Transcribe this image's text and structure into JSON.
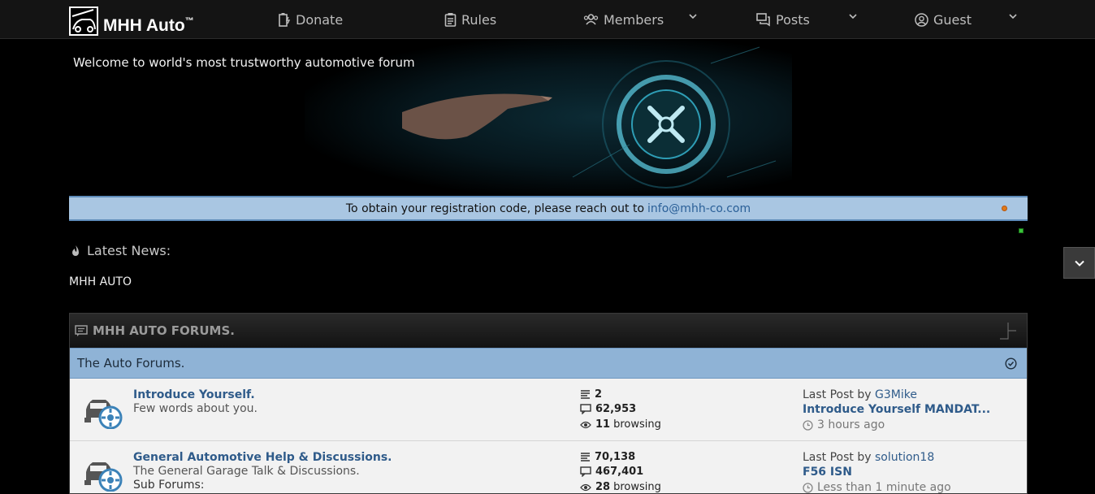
{
  "brand": {
    "name": "MHH Auto",
    "tm": "™"
  },
  "nav": [
    {
      "label": "Donate",
      "icon": "battery-icon"
    },
    {
      "label": "Rules",
      "icon": "clipboard-icon"
    },
    {
      "label": "Members",
      "icon": "users-icon"
    },
    {
      "label": "Posts",
      "icon": "chat-icon"
    },
    {
      "label": "Guest",
      "icon": "user-circle-icon"
    }
  ],
  "banner": {
    "title": "Welcome to world's most trustworthy automotive forum"
  },
  "notice": {
    "text": "To obtain your registration code, please reach out to",
    "email": "info@mhh-co.com"
  },
  "news": {
    "heading": "Latest News:",
    "text": "MHH AUTO"
  },
  "forum": {
    "title": "MHH AUTO FORUMS.",
    "category": "The Auto Forums.",
    "rows": [
      {
        "title": "Introduce Yourself.",
        "desc": "Few words about you.",
        "sub": "",
        "threads": "2",
        "posts": "62,953",
        "browsing": "11",
        "browsing_label": "browsing",
        "last_by_label": "Last Post by",
        "last_user": "G3Mike",
        "last_thread": "Introduce Yourself MANDAT...",
        "last_time": "3 hours ago"
      },
      {
        "title": "General Automotive Help & Discussions.",
        "desc": "The General Garage Talk & Discussions.",
        "sub": "Sub Forums:",
        "threads": "70,138",
        "posts": "467,401",
        "browsing": "28",
        "browsing_label": "browsing",
        "last_by_label": "Last Post by",
        "last_user": "solution18",
        "last_thread": "F56 ISN",
        "last_time": "Less than 1 minute ago"
      }
    ]
  },
  "colors": {
    "accent": "#2f5b8a",
    "notice_bg": "#a9c6e2",
    "category_bg": "#8fb3d6"
  }
}
